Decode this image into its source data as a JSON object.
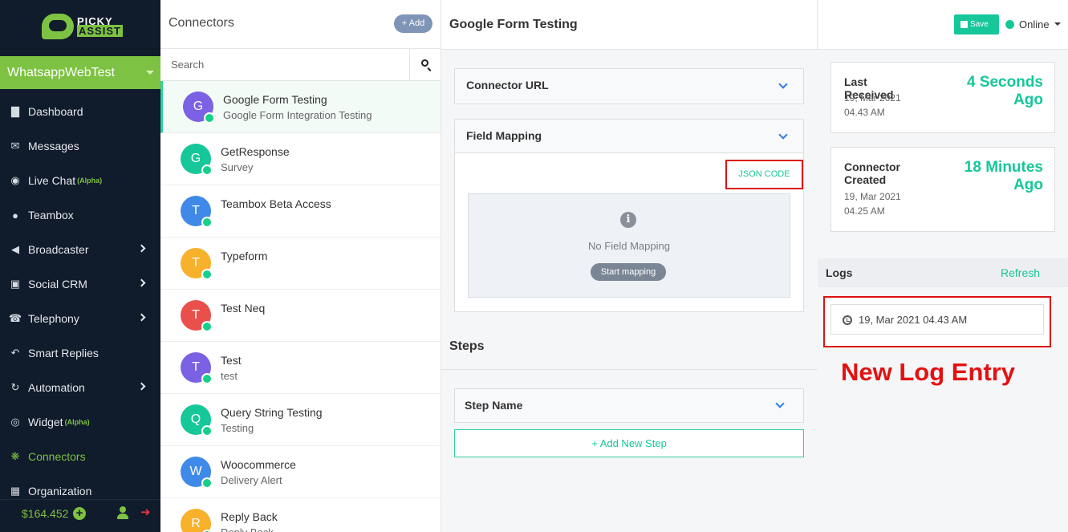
{
  "brand": {
    "wordmark_top": "PICKY",
    "wordmark_bottom": "ASSIST"
  },
  "account": {
    "name": "WhatsappWebTest"
  },
  "colors": {
    "accent": "#16c79a",
    "brand_green": "#7dc242",
    "sidebar_bg": "#101b2b",
    "annotation_red": "#e31212"
  },
  "nav": [
    {
      "label": "Dashboard",
      "icon": "bar-chart-icon",
      "sup": "",
      "chevron": false,
      "active": false
    },
    {
      "label": "Messages",
      "icon": "envelope-icon",
      "sup": "",
      "chevron": false,
      "active": false
    },
    {
      "label": "Live Chat",
      "icon": "chat-bubbles-icon",
      "sup": "(Alpha)",
      "chevron": false,
      "active": false
    },
    {
      "label": "Teambox",
      "icon": "comments-icon",
      "sup": "",
      "chevron": false,
      "active": false
    },
    {
      "label": "Broadcaster",
      "icon": "megaphone-icon",
      "sup": "",
      "chevron": true,
      "active": false
    },
    {
      "label": "Social CRM",
      "icon": "cube-icon",
      "sup": "",
      "chevron": true,
      "active": false
    },
    {
      "label": "Telephony",
      "icon": "phone-icon",
      "sup": "",
      "chevron": true,
      "active": false
    },
    {
      "label": "Smart Replies",
      "icon": "reply-all-icon",
      "sup": "",
      "chevron": false,
      "active": false
    },
    {
      "label": "Automation",
      "icon": "refresh-icon",
      "sup": "",
      "chevron": true,
      "active": false
    },
    {
      "label": "Widget",
      "icon": "chat-widget-icon",
      "sup": "(Alpha)",
      "chevron": false,
      "active": false
    },
    {
      "label": "Connectors",
      "icon": "connectors-icon",
      "sup": "",
      "chevron": false,
      "active": true
    },
    {
      "label": "Organization",
      "icon": "building-icon",
      "sup": "",
      "chevron": false,
      "active": false
    }
  ],
  "footer": {
    "balance": "$164.452"
  },
  "connectors": {
    "title": "Connectors",
    "add_label": "+ Add",
    "search_placeholder": "Search",
    "items": [
      {
        "initial": "G",
        "name": "Google Form Testing",
        "subtitle": "Google Form Integration Testing",
        "color": "#7b61e4",
        "selected": true
      },
      {
        "initial": "G",
        "name": "GetResponse",
        "subtitle": "Survey",
        "color": "#16c79a",
        "selected": false
      },
      {
        "initial": "T",
        "name": "Teambox Beta Access",
        "subtitle": "",
        "color": "#3f8ae8",
        "selected": false
      },
      {
        "initial": "T",
        "name": "Typeform",
        "subtitle": "",
        "color": "#f7b12b",
        "selected": false
      },
      {
        "initial": "T",
        "name": "Test Neq",
        "subtitle": "",
        "color": "#e9504b",
        "selected": false
      },
      {
        "initial": "T",
        "name": "Test",
        "subtitle": "test",
        "color": "#7b61e4",
        "selected": false
      },
      {
        "initial": "Q",
        "name": "Query String Testing",
        "subtitle": "Testing",
        "color": "#16c79a",
        "selected": false
      },
      {
        "initial": "W",
        "name": "Woocommerce",
        "subtitle": "Delivery Alert",
        "color": "#3f8ae8",
        "selected": false
      },
      {
        "initial": "R",
        "name": "Reply Back",
        "subtitle": "Reply Back",
        "color": "#f7b12b",
        "selected": false
      }
    ]
  },
  "detail": {
    "title": "Google Form Testing",
    "connector_url_label": "Connector URL",
    "field_mapping_label": "Field Mapping",
    "json_code_label": "JSON CODE",
    "empty_text": "No Field Mapping",
    "start_mapping_label": "Start mapping",
    "steps_title": "Steps",
    "step_name_label": "Step Name",
    "add_step_label": "+ Add New Step"
  },
  "header": {
    "save_label": "Save",
    "status": "Online"
  },
  "stats": {
    "last_received": {
      "label": "Last Received",
      "date": "19, Mar 2021 04.43 AM",
      "value": "4 Seconds Ago"
    },
    "connector_created": {
      "label": "Connector Created",
      "date": "19, Mar 2021 04.25 AM",
      "value": "18 Minutes Ago"
    }
  },
  "logs": {
    "title": "Logs",
    "refresh_label": "Refresh",
    "entries": [
      "19, Mar 2021 04.43 AM"
    ]
  },
  "annotation": "New Log Entry"
}
